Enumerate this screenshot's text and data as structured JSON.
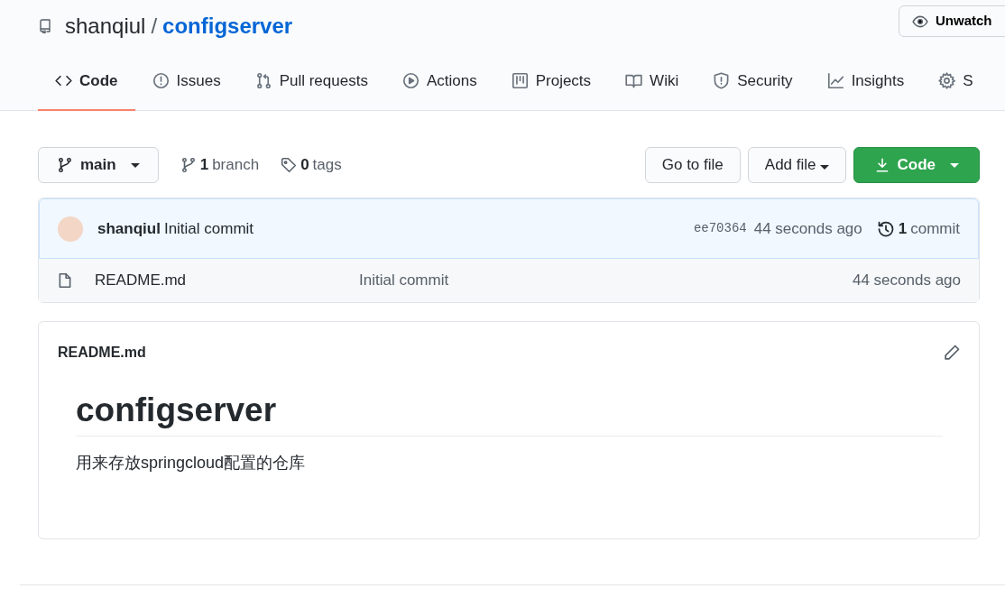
{
  "repo": {
    "owner": "shanqiul",
    "separator": "/",
    "name": "configserver"
  },
  "watch_button": {
    "label": "Unwatch"
  },
  "tabs": [
    {
      "label": "Code",
      "selected": true
    },
    {
      "label": "Issues",
      "selected": false
    },
    {
      "label": "Pull requests",
      "selected": false
    },
    {
      "label": "Actions",
      "selected": false
    },
    {
      "label": "Projects",
      "selected": false
    },
    {
      "label": "Wiki",
      "selected": false
    },
    {
      "label": "Security",
      "selected": false
    },
    {
      "label": "Insights",
      "selected": false
    },
    {
      "label": "S",
      "selected": false
    }
  ],
  "branch_button": {
    "label": "main"
  },
  "branch_count": {
    "count": "1",
    "label": "branch"
  },
  "tag_count": {
    "count": "0",
    "label": "tags"
  },
  "buttons": {
    "go_to_file": "Go to file",
    "add_file": "Add file",
    "code": "Code"
  },
  "latest_commit": {
    "author": "shanqiul",
    "message": "Initial commit",
    "sha": "ee70364",
    "time": "44 seconds ago",
    "commit_count": "1",
    "commit_label": "commit"
  },
  "files": [
    {
      "name": "README.md",
      "message": "Initial commit",
      "time": "44 seconds ago"
    }
  ],
  "readme": {
    "filename": "README.md",
    "heading": "configserver",
    "text": "用来存放springcloud配置的仓库"
  }
}
